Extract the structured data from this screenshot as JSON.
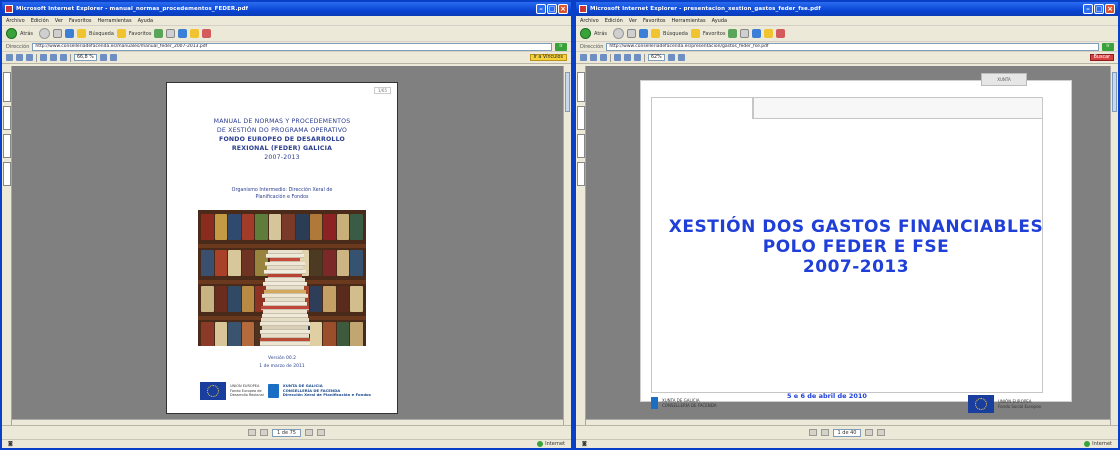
{
  "left_window": {
    "title": "Microsoft Internet Explorer - manual_normas_procedementos_FEDER.pdf",
    "menu": [
      "Archivo",
      "Edición",
      "Ver",
      "Favoritos",
      "Herramientas",
      "Ayuda"
    ],
    "nav": {
      "back": "Atrás",
      "search": "Búsqueda",
      "favorites": "Favoritos"
    },
    "address_label": "Dirección",
    "address": "http://www.conselleriadefacenda.es/manuales/manual_feder_2007-2013.pdf",
    "go": "Ir",
    "pdfbar": {
      "zoom": "66,8 %",
      "highlight": "Ir a Vínculos"
    },
    "page_field": "1 de 75",
    "status": "Internet",
    "page": {
      "corner": "1/65",
      "title_lines": [
        "MANUAL DE NORMAS Y PROCEDEMENTOS",
        "DE XESTIÓN DO PROGRAMA OPERATIVO"
      ],
      "title_bold_lines": [
        "FONDO EUROPEO DE DESARROLLO",
        "REXIONAL (FEDER) GALICIA"
      ],
      "years": "2007-2013",
      "subtitle_lines": [
        "Organismo Intermedio: Dirección Xeral de",
        "Planificación e Fondos"
      ],
      "version": "Versión 00.2",
      "date": "1 de marzo de 2011",
      "eu_text": [
        "UNIÓN EUROPEA",
        "Fondo Europeo de",
        "Desarrollo Rexional"
      ],
      "xunta_text": [
        "XUNTA DE GALICIA",
        "CONSELLERÍA DE FACENDA",
        "Dirección Xeral de Planificación e Fondos"
      ]
    }
  },
  "right_window": {
    "title": "Microsoft Internet Explorer - presentacion_xestion_gastos_feder_fse.pdf",
    "menu": [
      "Archivo",
      "Edición",
      "Ver",
      "Favoritos",
      "Herramientas",
      "Ayuda"
    ],
    "nav": {
      "back": "Atrás",
      "search": "Búsqueda",
      "favorites": "Favoritos"
    },
    "address_label": "Dirección",
    "address": "http://www.conselleriadefacenda.es/presentacion/gastos_feder_fse.pdf",
    "go": "Ir",
    "pdfbar": {
      "zoom": "62%",
      "highlight": "Buscar"
    },
    "page_field": "1 de 40",
    "status": "Internet",
    "page": {
      "tag": "XUNTA",
      "title_lines": [
        "XESTIÓN DOS GASTOS FINANCIABLES",
        "POLO FEDER E FSE",
        "2007-2013"
      ],
      "date": "5 e 6 de abril de 2010",
      "xunta_text": [
        "XUNTA DE GALICIA",
        "CONSELLERÍA DE FACENDA"
      ],
      "eu_text": [
        "UNIÓN EUROPEA",
        "Fondo Social Europeo"
      ]
    }
  },
  "colors": {
    "xp_blue": "#0a46d4",
    "title_blue": "#1f3fd8",
    "doc_blue": "#2a3d8f",
    "viewer_gray": "#808080"
  }
}
